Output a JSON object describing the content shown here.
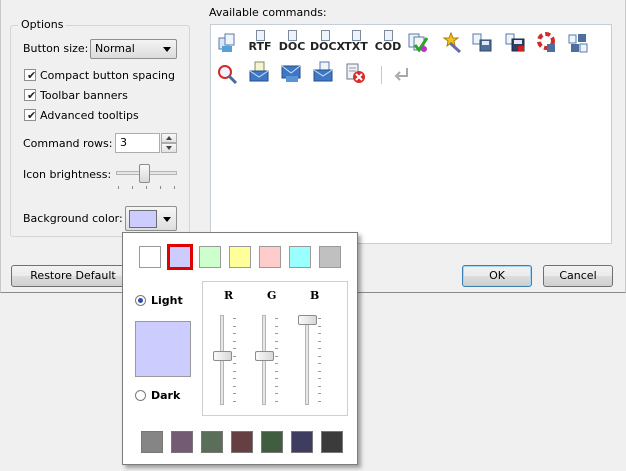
{
  "options": {
    "group_title": "Options",
    "button_size_label": "Button size:",
    "button_size_value": "Normal",
    "compact_spacing_label": "Compact button spacing",
    "compact_spacing_checked": true,
    "toolbar_banners_label": "Toolbar banners",
    "toolbar_banners_checked": true,
    "advanced_tooltips_label": "Advanced tooltips",
    "advanced_tooltips_checked": true,
    "command_rows_label": "Command rows:",
    "command_rows_value": "3",
    "icon_brightness_label": "Icon brightness:",
    "icon_brightness_level": 0.45,
    "background_color_label": "Background color:",
    "background_color_value": "#ccccff"
  },
  "commands": {
    "label": "Available commands:",
    "row1_text_icons": [
      "RTF",
      "DOC",
      "DOCX",
      "TXT",
      "COD"
    ],
    "icon_names": [
      "copy-clipboard-icon",
      "rtf-export-icon",
      "doc-export-icon",
      "docx-export-icon",
      "txt-export-icon",
      "cod-export-icon",
      "check-docs-icon",
      "magic-wand-icon",
      "save-all-icon",
      "save-icon",
      "help-icon",
      "network-save-icon",
      "find-icon",
      "email-doc-icon",
      "email-icon",
      "email-all-icon",
      "delete-doc-icon",
      "return-icon"
    ]
  },
  "buttons": {
    "restore_default": "Restore Default",
    "ok": "OK",
    "cancel": "Cancel"
  },
  "color_popup": {
    "top_swatches": [
      "#ffffff",
      "#ccccff",
      "#ccffcc",
      "#ffff99",
      "#ffcccc",
      "#99ffff",
      "#c0c0c0"
    ],
    "selected_index": 1,
    "light_label": "Light",
    "dark_label": "Dark",
    "mode": "light",
    "preview_color": "#ccccff",
    "channels": [
      {
        "label": "R",
        "level": 0.55
      },
      {
        "label": "G",
        "level": 0.55
      },
      {
        "label": "B",
        "level": 1.0
      }
    ],
    "bottom_swatches": [
      "#858585",
      "#735b74",
      "#5b6e5a",
      "#653f41",
      "#405d3f",
      "#3f3d5f",
      "#3b3b3b"
    ]
  }
}
